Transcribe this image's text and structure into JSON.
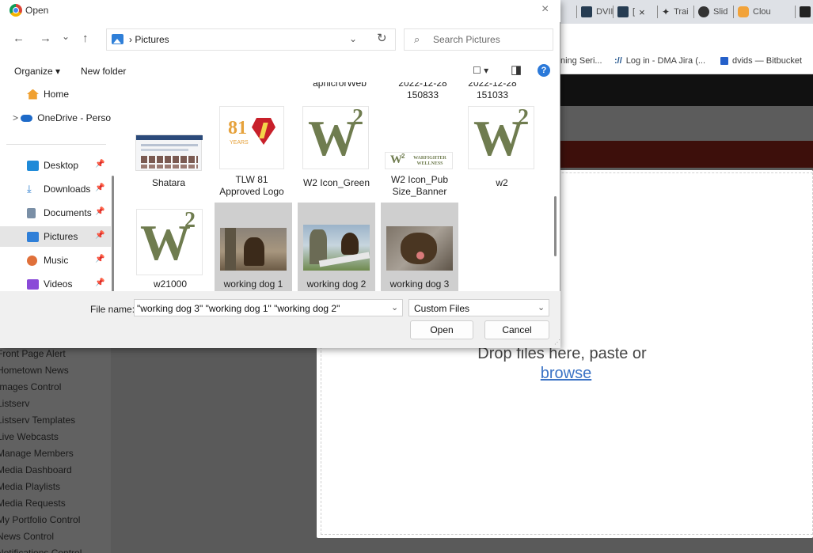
{
  "browser": {
    "tabs": [
      {
        "label": "DVII",
        "icon": "dvids-icon",
        "color": "#263c52"
      },
      {
        "label": "[",
        "icon": "dvids-icon",
        "color": "#263c52",
        "close": "×"
      },
      {
        "label": "Trai",
        "icon": "training-icon",
        "color": "#3a3a3a"
      },
      {
        "label": "Slid",
        "icon": "github-icon",
        "color": "#333333"
      },
      {
        "label": "Clou",
        "icon": "cloud-icon",
        "color": "#f2a33a"
      }
    ],
    "bookmarks": [
      {
        "label": "ning Seri...",
        "icon": ""
      },
      {
        "label": "Log in - DMA Jira (...",
        "icon": "://"
      },
      {
        "label": "dvids — Bitbucket",
        "icon": "bitbucket-icon"
      }
    ],
    "dropzone": {
      "text": "Drop files here, paste or",
      "link": "browse"
    },
    "left_nav": [
      "Front Page Alert",
      "Hometown News",
      "Images Control",
      "Listserv",
      "Listserv Templates",
      "Live Webcasts",
      "Manage Members",
      "Media Dashboard",
      "Media Playlists",
      "Media Requests",
      "My Portfolio Control",
      "News Control",
      "Notifications Control"
    ]
  },
  "dialog": {
    "title": "Open",
    "close": "×",
    "nav": {
      "back": "←",
      "forward": "→",
      "recent": "⌄",
      "up": "↑",
      "refresh": "↻"
    },
    "breadcrumb": "›  Pictures",
    "address_dropdown": "⌄",
    "search_placeholder": "Search Pictures",
    "organize": "Organize ▾",
    "new_folder": "New folder",
    "view_menu": "☐ ▾",
    "preview_pane": "◨",
    "help": "?",
    "nav_pane": [
      {
        "label": "Home",
        "icon": "home-icon",
        "color": "#f0a030",
        "pinned": false,
        "expander": ""
      },
      {
        "label": "OneDrive - Perso",
        "icon": "onedrive-icon",
        "color": "#1e6ac8",
        "pinned": false,
        "expander": ">"
      },
      {
        "label": "Desktop",
        "icon": "desktop-icon",
        "color": "#1f8ad8",
        "pinned": true,
        "expander": ""
      },
      {
        "label": "Downloads",
        "icon": "download-icon",
        "color": "#2277cc",
        "pinned": true,
        "expander": ""
      },
      {
        "label": "Documents",
        "icon": "documents-icon",
        "color": "#7a8fa6",
        "pinned": true,
        "expander": ""
      },
      {
        "label": "Pictures",
        "icon": "pictures-icon",
        "color": "#2f7fd8",
        "pinned": true,
        "expander": ""
      },
      {
        "label": "Music",
        "icon": "music-icon",
        "color": "#e0703a",
        "pinned": true,
        "expander": ""
      },
      {
        "label": "Videos",
        "icon": "videos-icon",
        "color": "#8a4ad8",
        "pinned": true,
        "expander": ""
      }
    ],
    "files_top_row": [
      {
        "label": "apnicrorWeb"
      },
      {
        "label": "2022-12-28\n150833"
      },
      {
        "label": "2022-12-28\n151033"
      }
    ],
    "files": [
      {
        "label": "Shatara",
        "thumb": "screenshot",
        "selected": false
      },
      {
        "label": "TLW 81\nApproved Logo",
        "thumb": "logo81",
        "selected": false
      },
      {
        "label": "W2 Icon_Green",
        "thumb": "w2",
        "selected": false
      },
      {
        "label": "W2 Icon_Pub\nSize_Banner",
        "thumb": "w2banner",
        "selected": false
      },
      {
        "label": "w2",
        "thumb": "w2",
        "selected": false
      },
      {
        "label": "w21000",
        "thumb": "w2",
        "selected": false
      },
      {
        "label": "working dog 1",
        "thumb": "dog1",
        "selected": true
      },
      {
        "label": "working dog 2",
        "thumb": "dog2",
        "selected": true
      },
      {
        "label": "working dog 3",
        "thumb": "dog3",
        "selected": true
      }
    ],
    "logo_text": {
      "w": "W",
      "sup": "2",
      "num": "81",
      "years": "YEARS",
      "banner": "WARFIGHTER WELLNESS"
    },
    "file_name_label": "File name:",
    "file_name_value": "\"working dog 3\" \"working dog 1\" \"working dog 2\"",
    "file_type": "Custom Files",
    "open_label": "Open",
    "cancel_label": "Cancel",
    "colors": {
      "w2_green": "#6f7c4f",
      "selection": "#cfcfcf",
      "accent": "#2f7fd8"
    }
  }
}
